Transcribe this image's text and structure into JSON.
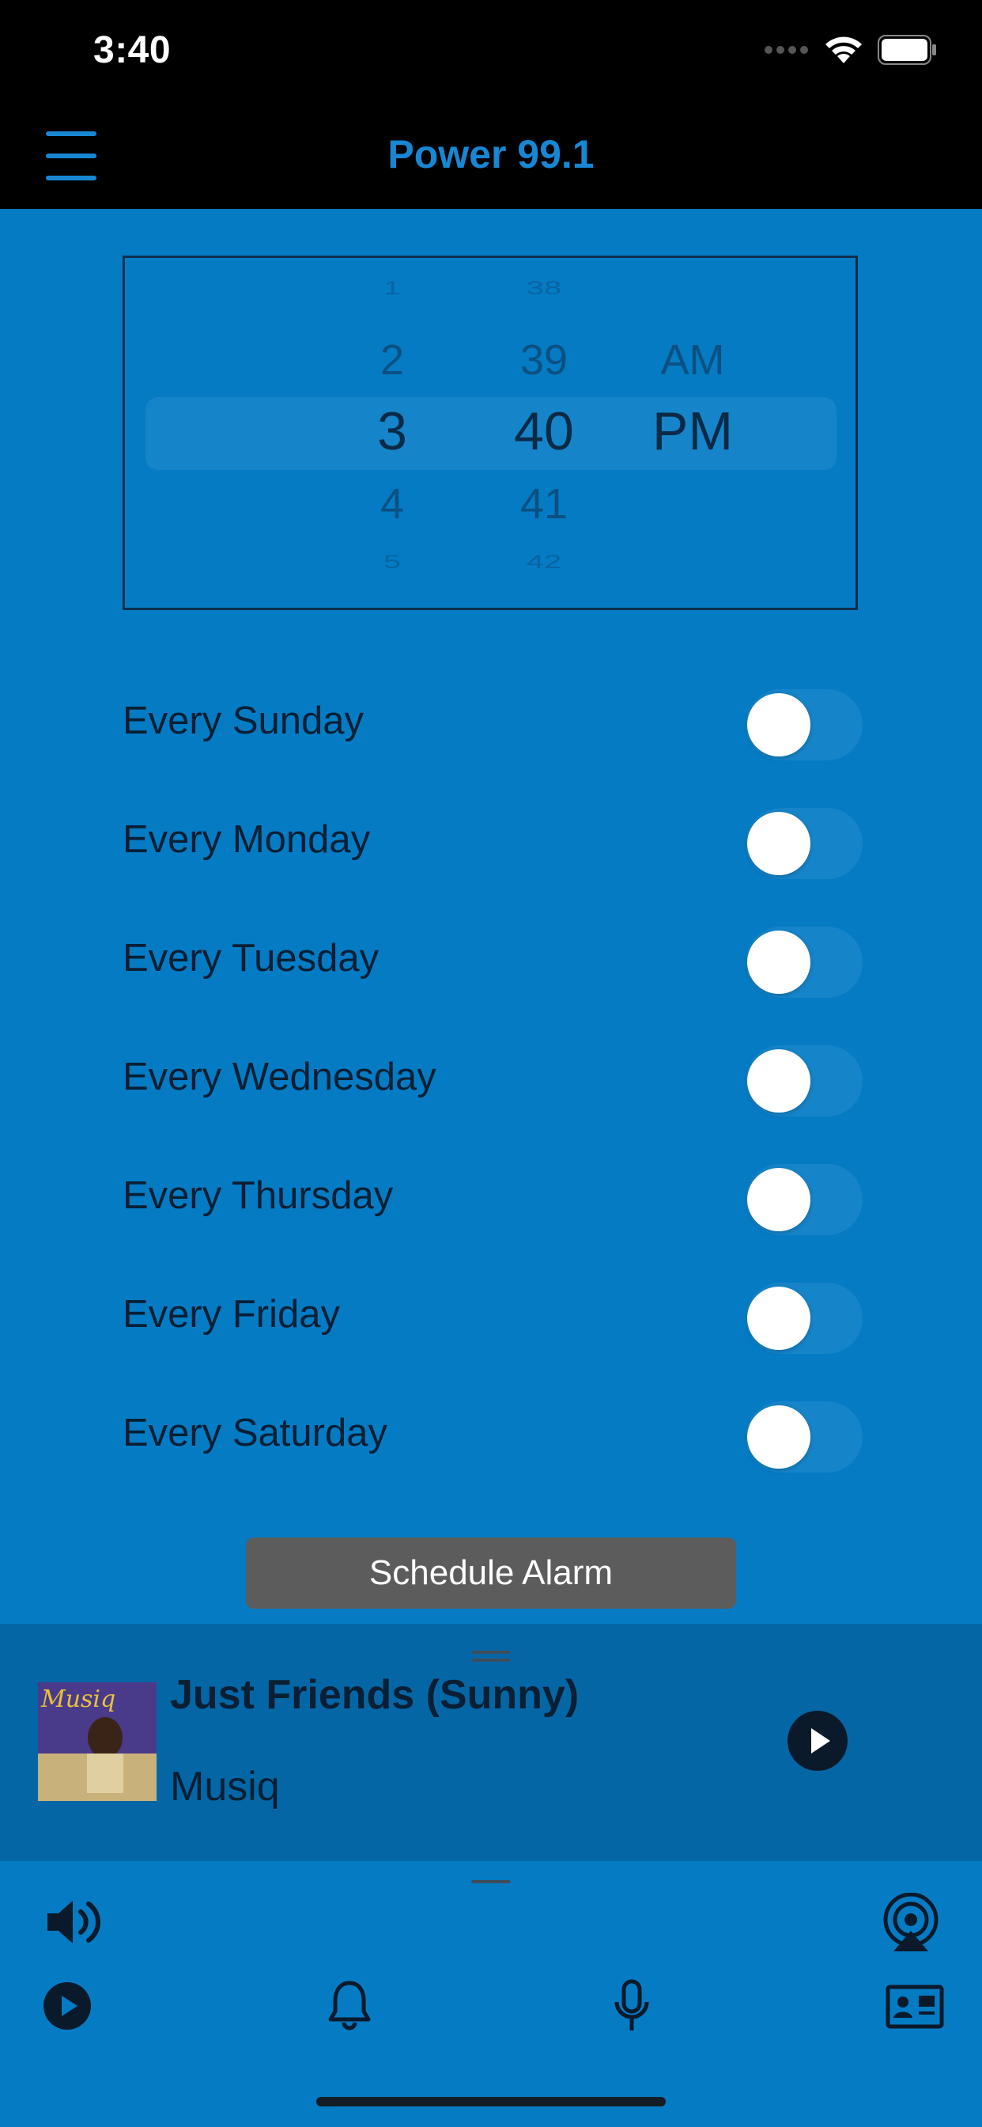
{
  "status_bar": {
    "time": "3:40"
  },
  "nav": {
    "title": "Power 99.1"
  },
  "time_picker": {
    "hours": [
      "1",
      "2",
      "3",
      "4",
      "5"
    ],
    "minutes": [
      "38",
      "39",
      "40",
      "41",
      "42"
    ],
    "periods": [
      "AM",
      "PM"
    ],
    "selected": {
      "hour": "3",
      "minute": "40",
      "period": "PM"
    }
  },
  "repeat_days": [
    {
      "label": "Every Sunday",
      "enabled": false
    },
    {
      "label": "Every Monday",
      "enabled": false
    },
    {
      "label": "Every Tuesday",
      "enabled": false
    },
    {
      "label": "Every Wednesday",
      "enabled": false
    },
    {
      "label": "Every Thursday",
      "enabled": false
    },
    {
      "label": "Every Friday",
      "enabled": false
    },
    {
      "label": "Every Saturday",
      "enabled": false
    }
  ],
  "schedule_button": {
    "label": "Schedule Alarm"
  },
  "now_playing": {
    "track": "Just Friends (Sunny)",
    "artist": "Musiq",
    "album_art_text": "Musiq"
  },
  "colors": {
    "accent": "#1787D4",
    "background": "#057BC4",
    "player_bg": "#0566A6"
  },
  "icons": [
    "menu-icon",
    "volume-icon",
    "airplay-icon",
    "play-icon",
    "bell-icon",
    "microphone-icon",
    "contact-card-icon"
  ]
}
